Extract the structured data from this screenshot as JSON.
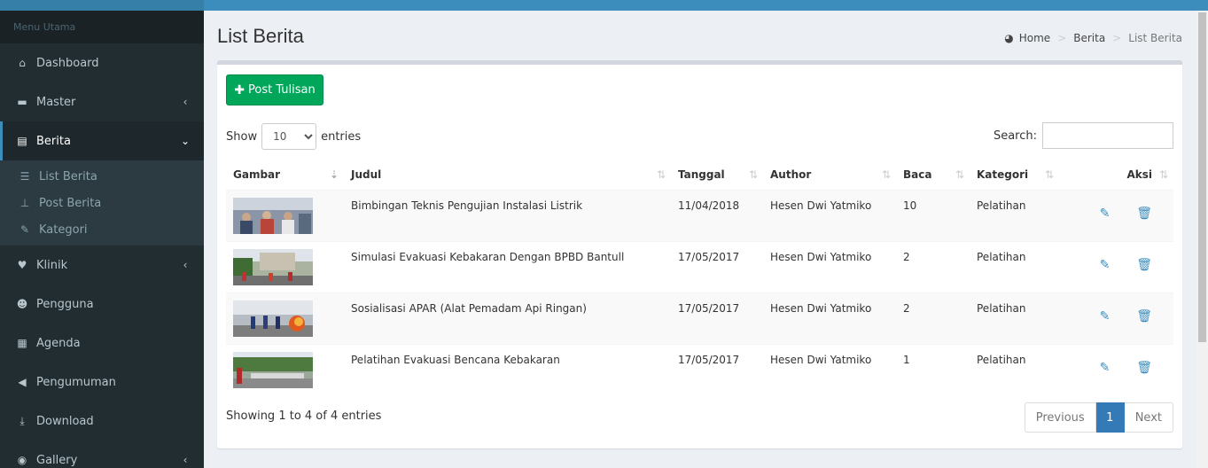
{
  "sidebar": {
    "header": "Menu Utama",
    "items": [
      {
        "label": "Dashboard",
        "icon": "home-icon",
        "glyph": "⌂",
        "chevron": ""
      },
      {
        "label": "Master",
        "icon": "archive-icon",
        "glyph": "▬",
        "chevron": "‹"
      },
      {
        "label": "Berita",
        "icon": "newspaper-icon",
        "glyph": "▤",
        "chevron": "⌄"
      },
      {
        "label": "Klinik",
        "icon": "heartbeat-icon",
        "glyph": "♥",
        "chevron": "‹"
      },
      {
        "label": "Pengguna",
        "icon": "users-icon",
        "glyph": "☻",
        "chevron": ""
      },
      {
        "label": "Agenda",
        "icon": "calendar-icon",
        "glyph": "▦",
        "chevron": ""
      },
      {
        "label": "Pengumuman",
        "icon": "volume-icon",
        "glyph": "◀",
        "chevron": ""
      },
      {
        "label": "Download",
        "icon": "download-icon",
        "glyph": "⤓",
        "chevron": ""
      },
      {
        "label": "Gallery",
        "icon": "camera-icon",
        "glyph": "◉",
        "chevron": "‹"
      }
    ],
    "submenu": [
      {
        "label": "List Berita",
        "icon": "list-icon",
        "glyph": "☰"
      },
      {
        "label": "Post Berita",
        "icon": "pin-icon",
        "glyph": "⊥"
      },
      {
        "label": "Kategori",
        "icon": "wrench-icon",
        "glyph": "✎"
      }
    ]
  },
  "page": {
    "title": "List Berita",
    "breadcrumb": [
      "Home",
      "Berita",
      "List Berita"
    ]
  },
  "toolbar": {
    "post_label": "Post Tulisan"
  },
  "table_controls": {
    "show_label": "Show",
    "entries_label": "entries",
    "page_length": "10",
    "search_label": "Search:",
    "search_value": ""
  },
  "table": {
    "columns": [
      "Gambar",
      "Judul",
      "Tanggal",
      "Author",
      "Baca",
      "Kategori",
      "Aksi"
    ],
    "rows": [
      {
        "judul": "Bimbingan Teknis Pengujian Instalasi Listrik",
        "tanggal": "11/04/2018",
        "author": "Hesen Dwi Yatmiko",
        "baca": "10",
        "kategori": "Pelatihan"
      },
      {
        "judul": "Simulasi Evakuasi Kebakaran Dengan BPBD Bantull",
        "tanggal": "17/05/2017",
        "author": "Hesen Dwi Yatmiko",
        "baca": "2",
        "kategori": "Pelatihan"
      },
      {
        "judul": "Sosialisasi APAR (Alat Pemadam Api Ringan)",
        "tanggal": "17/05/2017",
        "author": "Hesen Dwi Yatmiko",
        "baca": "2",
        "kategori": "Pelatihan"
      },
      {
        "judul": "Pelatihan Evakuasi Bencana Kebakaran",
        "tanggal": "17/05/2017",
        "author": "Hesen Dwi Yatmiko",
        "baca": "1",
        "kategori": "Pelatihan"
      }
    ]
  },
  "footer": {
    "info": "Showing 1 to 4 of 4 entries",
    "previous": "Previous",
    "current": "1",
    "next": "Next"
  },
  "colors": {
    "accent": "#3c8dbc",
    "success": "#00a65a",
    "sidebar": "#222d32"
  }
}
